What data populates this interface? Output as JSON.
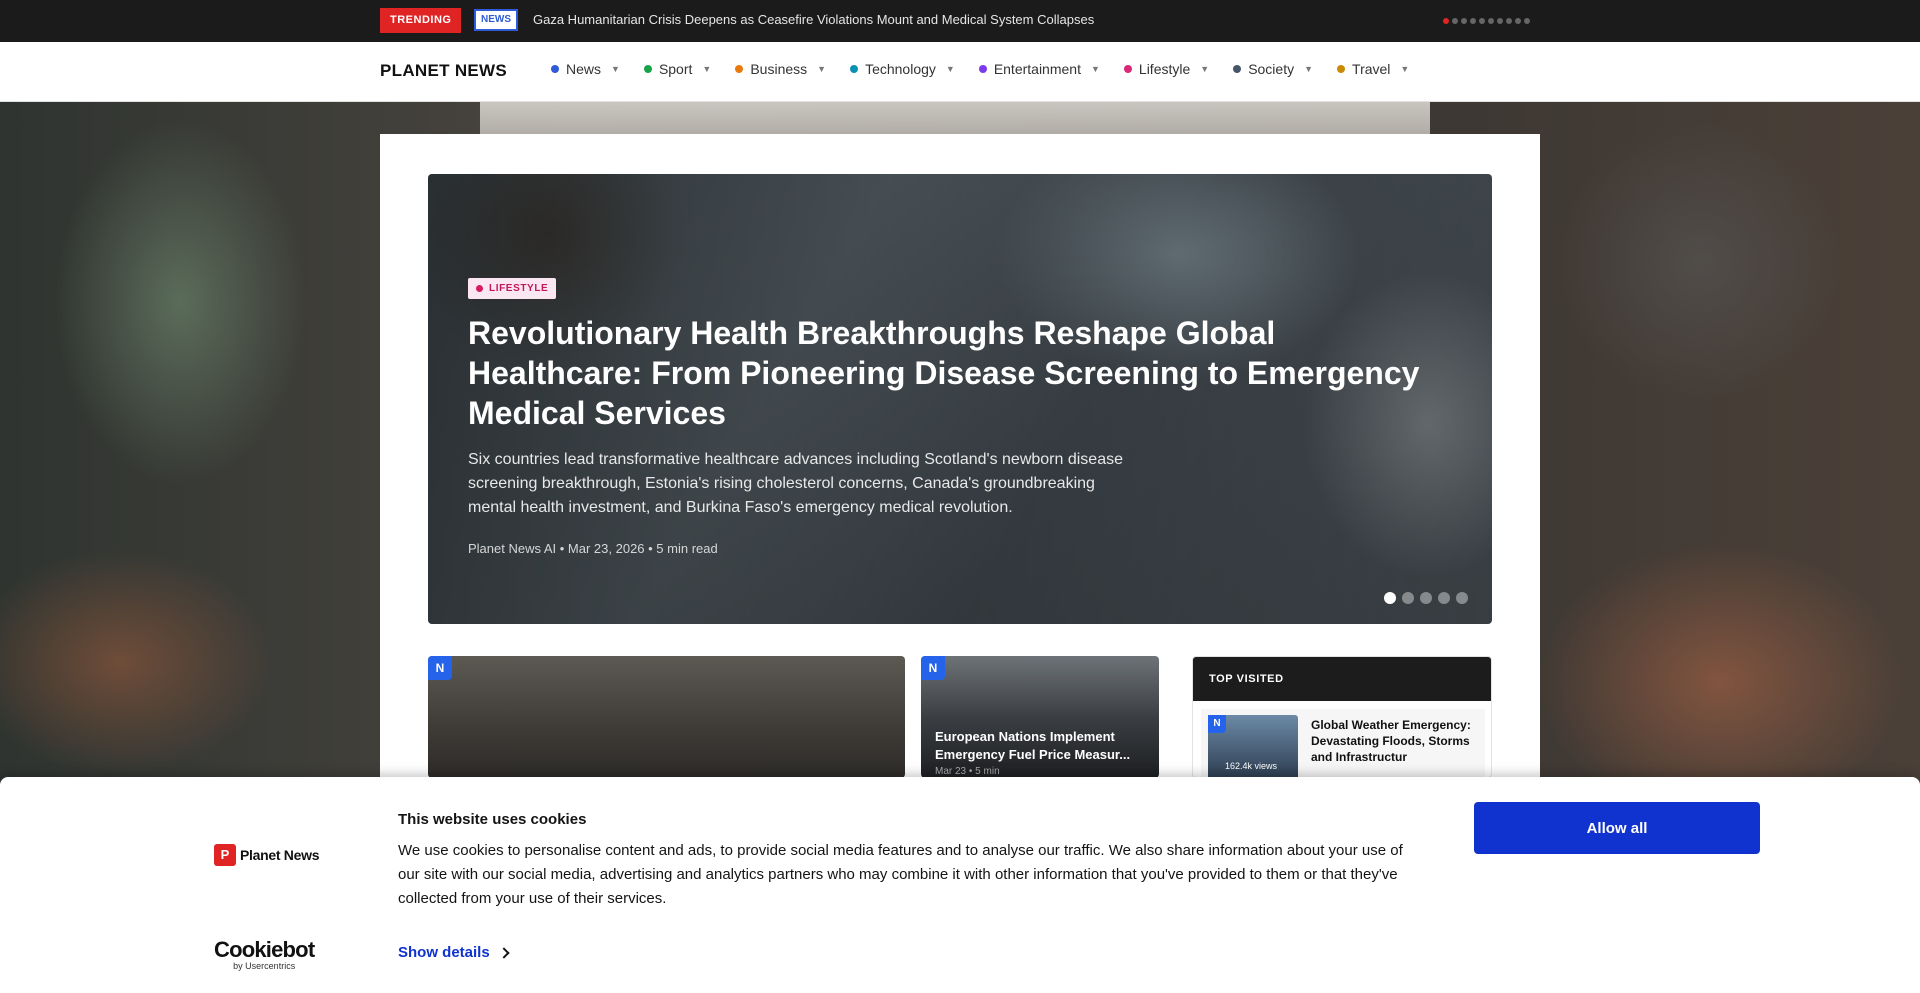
{
  "trending": {
    "badge": "TRENDING",
    "news_badge": "NEWS",
    "headline": "Gaza Humanitarian Crisis Deepens as Ceasefire Violations Mount and Medical System Collapses",
    "dots": 10,
    "active_dot": 0
  },
  "nav": {
    "logo": "PLANET NEWS",
    "items": [
      {
        "label": "News",
        "color": "#2f5bd6"
      },
      {
        "label": "Sport",
        "color": "#16a34a"
      },
      {
        "label": "Business",
        "color": "#ea7a0c"
      },
      {
        "label": "Technology",
        "color": "#0891b2"
      },
      {
        "label": "Entertainment",
        "color": "#7c3aed"
      },
      {
        "label": "Lifestyle",
        "color": "#db2777"
      },
      {
        "label": "Society",
        "color": "#475569"
      },
      {
        "label": "Travel",
        "color": "#ca8a04"
      }
    ]
  },
  "hero": {
    "category": "LIFESTYLE",
    "title": "Revolutionary Health Breakthroughs Reshape Global Healthcare: From Pioneering Disease Screening to Emergency Medical Services",
    "description": "Six countries lead transformative healthcare advances including Scotland's newborn disease screening breakthrough, Estonia's rising cholesterol concerns, Canada's groundbreaking mental health investment, and Burkina Faso's emergency medical revolution.",
    "meta": "Planet News AI • Mar 23, 2026 • 5 min read",
    "slides": 5,
    "active_slide": 0
  },
  "cards": {
    "card_a": {
      "badge": "N"
    },
    "card_b": {
      "badge": "N",
      "title": "European Nations Implement Emergency Fuel Price Measur...",
      "meta": "Mar 23 • 5 min"
    }
  },
  "top_visited": {
    "heading": "TOP VISITED",
    "items": [
      {
        "badge": "N",
        "title": "Global Weather Emergency: Devastating Floods, Storms and Infrastructur",
        "views": "162.4k views"
      }
    ]
  },
  "cookie": {
    "brand": "Planet News",
    "brand_mark": "P",
    "provider": "Cookiebot",
    "provider_sub": "by Usercentrics",
    "title": "This website uses cookies",
    "text": "We use cookies to personalise content and ads, to provide social media features and to analyse our traffic. We also share information about your use of our site with our social media, advertising and analytics partners who may combine it with other information that you've provided to them or that they've collected from your use of their services.",
    "details_label": "Show details",
    "allow_label": "Allow all"
  }
}
